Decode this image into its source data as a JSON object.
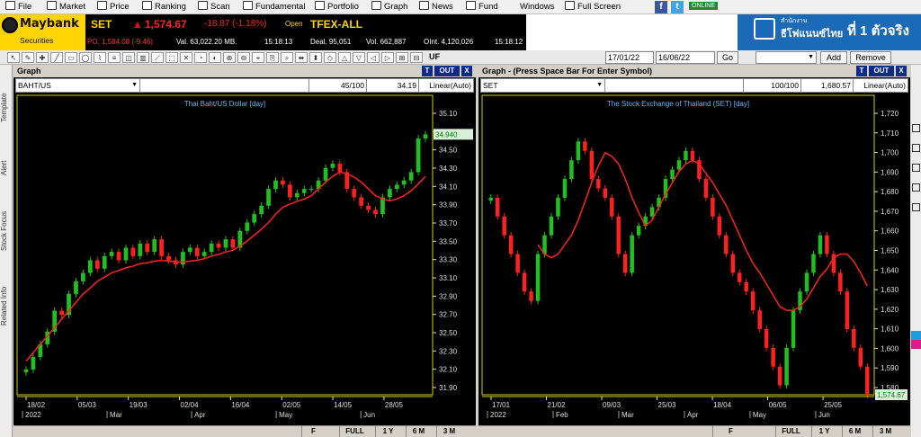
{
  "menu": {
    "items": [
      "File",
      "Market",
      "Price",
      "Ranking",
      "Scan",
      "Fundamental",
      "Portfolio",
      "Graph",
      "News",
      "Fund",
      "Windows",
      "Full Screen"
    ],
    "online": "ONLINE"
  },
  "brand": {
    "name": "Maybank",
    "sub": "Securities"
  },
  "ticker": {
    "set_label": "SET",
    "set_value": "1,574.67",
    "set_change": "-18.87 (-1.18%)",
    "status": "Open",
    "tfex": "TFEX-ALL",
    "po": "PO. 1,584.08 (-9.46)",
    "val": "Val. 63,022.20 MB.",
    "time1": "15:18:13",
    "deal": "Deal. 95,051",
    "vol": "Vol. 662,887",
    "oint": "OInt. 4,120,026",
    "time2": "15:18:12"
  },
  "ad": {
    "line1": "สำนักงาน",
    "line2": "ธีโฟแนนซ์ไทย",
    "line3": "ที่ 1 ตัวจริง"
  },
  "toolbar": {
    "uf": "UF",
    "date_from": "17/01/22",
    "date_to": "16/06/22",
    "go": "Go",
    "add": "Add",
    "remove": "Remove"
  },
  "sidebar": {
    "labels": [
      "Template",
      "Alert",
      "Stock Focus",
      "Related Info"
    ]
  },
  "panels": [
    {
      "title": "Graph",
      "symbol": "BAHT/US",
      "zoom": "45/100",
      "last": "34.19",
      "scale": "Linear(Auto)",
      "chart_title": "Thai Baht/US Dollar [day]",
      "price_tag": "34.940",
      "buttons": [
        "T",
        "OUT",
        "X"
      ],
      "yticks": [
        "35.10",
        "34.70",
        "34.50",
        "34.30",
        "34.10",
        "33.90",
        "33.70",
        "33.50",
        "33.30",
        "33.10",
        "32.90",
        "32.70",
        "32.50",
        "32.30",
        "32.10",
        "31.90"
      ],
      "xticks": [
        "18/02",
        "05/03",
        "19/03",
        "02/04",
        "16/04",
        "02/05",
        "14/05",
        "28/05"
      ],
      "months": [
        "2022",
        "Mar",
        "Apr",
        "May",
        "Jun"
      ],
      "ranges": [
        "FULL",
        "1 Y",
        "6 M",
        "3 M"
      ]
    },
    {
      "title": "Graph - (Press Space Bar For Enter Symbol)",
      "symbol": "SET",
      "zoom": "100/100",
      "last": "1,680.57",
      "scale": "Linear(Auto)",
      "chart_title": "The Stock Exchange of Thailand (SET) [day]",
      "price_tag": "1,574.67",
      "buttons": [
        "T",
        "OUT",
        "X"
      ],
      "yticks": [
        "1,720",
        "1,710",
        "1,700",
        "1,690",
        "1,680",
        "1,670",
        "1,660",
        "1,650",
        "1,640",
        "1,630",
        "1,620",
        "1,610",
        "1,600",
        "1,590",
        "1,580"
      ],
      "xticks": [
        "17/01",
        "21/02",
        "09/03",
        "25/03",
        "18/04",
        "06/05",
        "25/05"
      ],
      "months": [
        "2022",
        "Feb",
        "Mar",
        "Apr",
        "May",
        "Jun"
      ],
      "ranges": [
        "FULL",
        "1 Y",
        "6 M",
        "3 M"
      ]
    }
  ],
  "chart_data": [
    {
      "type": "candlestick",
      "title": "Thai Baht/US Dollar [day]",
      "ylim": [
        31.85,
        35.2
      ],
      "close": [
        32.15,
        32.3,
        32.45,
        32.6,
        32.85,
        32.8,
        33.05,
        33.2,
        33.3,
        33.45,
        33.35,
        33.5,
        33.55,
        33.45,
        33.6,
        33.5,
        33.65,
        33.55,
        33.7,
        33.5,
        33.45,
        33.4,
        33.55,
        33.6,
        33.5,
        33.55,
        33.65,
        33.6,
        33.7,
        33.6,
        33.8,
        33.9,
        34.0,
        34.1,
        34.3,
        34.4,
        34.35,
        34.2,
        34.25,
        34.3,
        34.3,
        34.4,
        34.55,
        34.6,
        34.5,
        34.3,
        34.2,
        34.1,
        34.05,
        34.0,
        34.2,
        34.3,
        34.35,
        34.4,
        34.5,
        34.9,
        34.95
      ],
      "ma": [
        32.25,
        32.35,
        32.45,
        32.55,
        32.65,
        32.75,
        32.85,
        32.95,
        33.05,
        33.12,
        33.2,
        33.25,
        33.3,
        33.33,
        33.36,
        33.38,
        33.41,
        33.42,
        33.44,
        33.45,
        33.44,
        33.43,
        33.43,
        33.44,
        33.45,
        33.47,
        33.5,
        33.52,
        33.55,
        33.57,
        33.62,
        33.68,
        33.75,
        33.82,
        33.9,
        34.0,
        34.08,
        34.12,
        34.15,
        34.18,
        34.22,
        34.3,
        34.38,
        34.45,
        34.5,
        34.48,
        34.44,
        34.38,
        34.3,
        34.22,
        34.18,
        34.16,
        34.18,
        34.22,
        34.28,
        34.36,
        34.45
      ]
    },
    {
      "type": "candlestick",
      "title": "The Stock Exchange of Thailand (SET) [day]",
      "ylim": [
        1575,
        1725
      ],
      "close": [
        1680,
        1670,
        1660,
        1650,
        1640,
        1630,
        1625,
        1650,
        1660,
        1670,
        1680,
        1690,
        1700,
        1710,
        1705,
        1690,
        1685,
        1680,
        1670,
        1650,
        1640,
        1660,
        1665,
        1670,
        1675,
        1680,
        1690,
        1695,
        1700,
        1705,
        1700,
        1690,
        1680,
        1670,
        1660,
        1650,
        1640,
        1635,
        1630,
        1620,
        1610,
        1600,
        1590,
        1580,
        1600,
        1620,
        1630,
        1640,
        1650,
        1660,
        1650,
        1640,
        1630,
        1610,
        1600,
        1590,
        1575
      ],
      "ma": [
        1655,
        1650,
        1648,
        1650,
        1655,
        1660,
        1668,
        1678,
        1688,
        1697,
        1704,
        1702,
        1698,
        1690,
        1680,
        1672,
        1665,
        1668,
        1675,
        1682,
        1688,
        1694,
        1698,
        1700,
        1698,
        1693,
        1688,
        1682,
        1676,
        1668,
        1660,
        1652,
        1645,
        1640,
        1634,
        1628,
        1622,
        1620,
        1620,
        1622,
        1626,
        1632,
        1638,
        1642,
        1648,
        1650,
        1650,
        1646,
        1640,
        1633
      ]
    }
  ]
}
